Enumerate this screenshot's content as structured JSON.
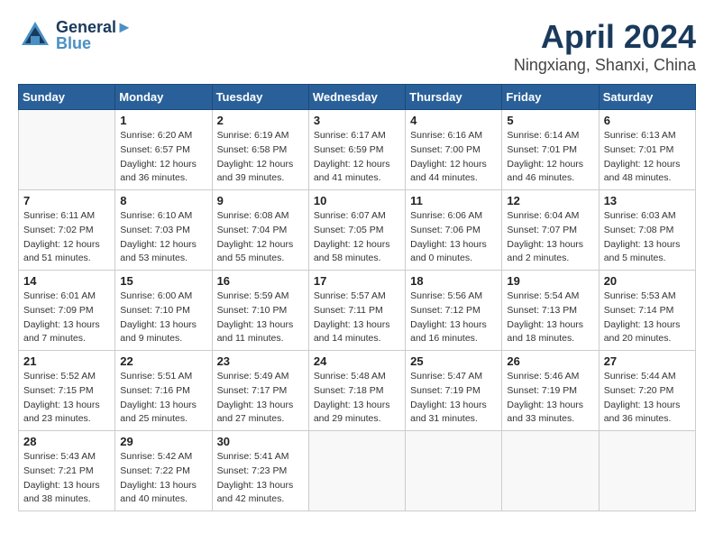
{
  "header": {
    "logo_top": "General",
    "logo_bottom": "Blue",
    "month": "April 2024",
    "location": "Ningxiang, Shanxi, China"
  },
  "weekdays": [
    "Sunday",
    "Monday",
    "Tuesday",
    "Wednesday",
    "Thursday",
    "Friday",
    "Saturday"
  ],
  "days": [
    {
      "date": "",
      "info": ""
    },
    {
      "date": "1",
      "info": "Sunrise: 6:20 AM\nSunset: 6:57 PM\nDaylight: 12 hours\nand 36 minutes."
    },
    {
      "date": "2",
      "info": "Sunrise: 6:19 AM\nSunset: 6:58 PM\nDaylight: 12 hours\nand 39 minutes."
    },
    {
      "date": "3",
      "info": "Sunrise: 6:17 AM\nSunset: 6:59 PM\nDaylight: 12 hours\nand 41 minutes."
    },
    {
      "date": "4",
      "info": "Sunrise: 6:16 AM\nSunset: 7:00 PM\nDaylight: 12 hours\nand 44 minutes."
    },
    {
      "date": "5",
      "info": "Sunrise: 6:14 AM\nSunset: 7:01 PM\nDaylight: 12 hours\nand 46 minutes."
    },
    {
      "date": "6",
      "info": "Sunrise: 6:13 AM\nSunset: 7:01 PM\nDaylight: 12 hours\nand 48 minutes."
    },
    {
      "date": "7",
      "info": "Sunrise: 6:11 AM\nSunset: 7:02 PM\nDaylight: 12 hours\nand 51 minutes."
    },
    {
      "date": "8",
      "info": "Sunrise: 6:10 AM\nSunset: 7:03 PM\nDaylight: 12 hours\nand 53 minutes."
    },
    {
      "date": "9",
      "info": "Sunrise: 6:08 AM\nSunset: 7:04 PM\nDaylight: 12 hours\nand 55 minutes."
    },
    {
      "date": "10",
      "info": "Sunrise: 6:07 AM\nSunset: 7:05 PM\nDaylight: 12 hours\nand 58 minutes."
    },
    {
      "date": "11",
      "info": "Sunrise: 6:06 AM\nSunset: 7:06 PM\nDaylight: 13 hours\nand 0 minutes."
    },
    {
      "date": "12",
      "info": "Sunrise: 6:04 AM\nSunset: 7:07 PM\nDaylight: 13 hours\nand 2 minutes."
    },
    {
      "date": "13",
      "info": "Sunrise: 6:03 AM\nSunset: 7:08 PM\nDaylight: 13 hours\nand 5 minutes."
    },
    {
      "date": "14",
      "info": "Sunrise: 6:01 AM\nSunset: 7:09 PM\nDaylight: 13 hours\nand 7 minutes."
    },
    {
      "date": "15",
      "info": "Sunrise: 6:00 AM\nSunset: 7:10 PM\nDaylight: 13 hours\nand 9 minutes."
    },
    {
      "date": "16",
      "info": "Sunrise: 5:59 AM\nSunset: 7:10 PM\nDaylight: 13 hours\nand 11 minutes."
    },
    {
      "date": "17",
      "info": "Sunrise: 5:57 AM\nSunset: 7:11 PM\nDaylight: 13 hours\nand 14 minutes."
    },
    {
      "date": "18",
      "info": "Sunrise: 5:56 AM\nSunset: 7:12 PM\nDaylight: 13 hours\nand 16 minutes."
    },
    {
      "date": "19",
      "info": "Sunrise: 5:54 AM\nSunset: 7:13 PM\nDaylight: 13 hours\nand 18 minutes."
    },
    {
      "date": "20",
      "info": "Sunrise: 5:53 AM\nSunset: 7:14 PM\nDaylight: 13 hours\nand 20 minutes."
    },
    {
      "date": "21",
      "info": "Sunrise: 5:52 AM\nSunset: 7:15 PM\nDaylight: 13 hours\nand 23 minutes."
    },
    {
      "date": "22",
      "info": "Sunrise: 5:51 AM\nSunset: 7:16 PM\nDaylight: 13 hours\nand 25 minutes."
    },
    {
      "date": "23",
      "info": "Sunrise: 5:49 AM\nSunset: 7:17 PM\nDaylight: 13 hours\nand 27 minutes."
    },
    {
      "date": "24",
      "info": "Sunrise: 5:48 AM\nSunset: 7:18 PM\nDaylight: 13 hours\nand 29 minutes."
    },
    {
      "date": "25",
      "info": "Sunrise: 5:47 AM\nSunset: 7:19 PM\nDaylight: 13 hours\nand 31 minutes."
    },
    {
      "date": "26",
      "info": "Sunrise: 5:46 AM\nSunset: 7:19 PM\nDaylight: 13 hours\nand 33 minutes."
    },
    {
      "date": "27",
      "info": "Sunrise: 5:44 AM\nSunset: 7:20 PM\nDaylight: 13 hours\nand 36 minutes."
    },
    {
      "date": "28",
      "info": "Sunrise: 5:43 AM\nSunset: 7:21 PM\nDaylight: 13 hours\nand 38 minutes."
    },
    {
      "date": "29",
      "info": "Sunrise: 5:42 AM\nSunset: 7:22 PM\nDaylight: 13 hours\nand 40 minutes."
    },
    {
      "date": "30",
      "info": "Sunrise: 5:41 AM\nSunset: 7:23 PM\nDaylight: 13 hours\nand 42 minutes."
    },
    {
      "date": "",
      "info": ""
    },
    {
      "date": "",
      "info": ""
    },
    {
      "date": "",
      "info": ""
    },
    {
      "date": "",
      "info": ""
    }
  ]
}
